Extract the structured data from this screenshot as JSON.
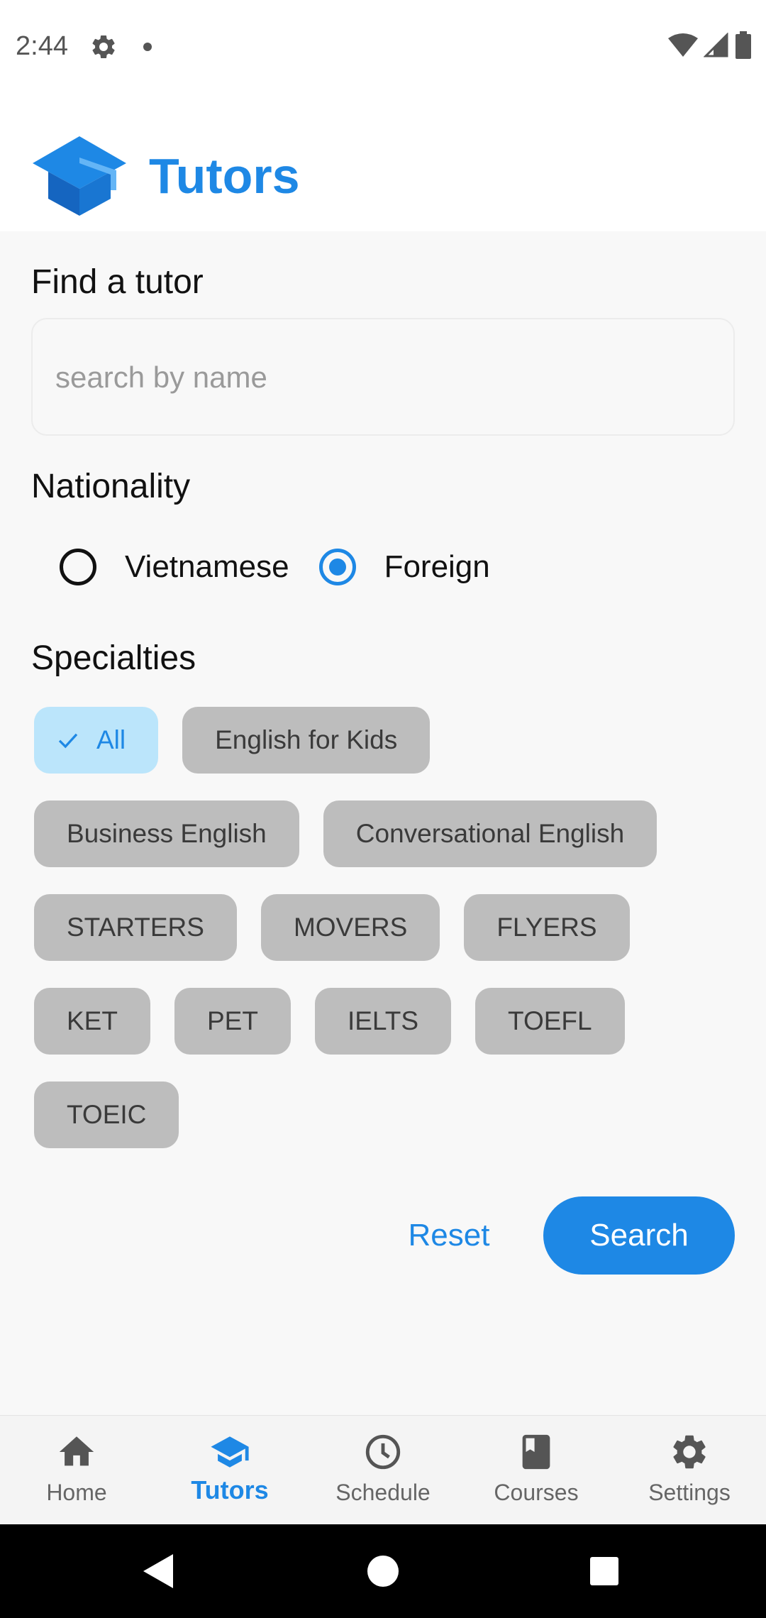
{
  "status_bar": {
    "time": "2:44"
  },
  "header": {
    "title": "Tutors"
  },
  "find": {
    "title": "Find a tutor",
    "search_value": "",
    "search_placeholder": "search by name"
  },
  "nationality": {
    "title": "Nationality",
    "options": [
      {
        "label": "Vietnamese",
        "selected": false
      },
      {
        "label": "Foreign",
        "selected": true
      }
    ]
  },
  "specialties": {
    "title": "Specialties",
    "chips": [
      {
        "label": "All",
        "selected": true
      },
      {
        "label": "English for Kids",
        "selected": false
      },
      {
        "label": "Business English",
        "selected": false
      },
      {
        "label": "Conversational English",
        "selected": false
      },
      {
        "label": "STARTERS",
        "selected": false
      },
      {
        "label": "MOVERS",
        "selected": false
      },
      {
        "label": "FLYERS",
        "selected": false
      },
      {
        "label": "KET",
        "selected": false
      },
      {
        "label": "PET",
        "selected": false
      },
      {
        "label": "IELTS",
        "selected": false
      },
      {
        "label": "TOEFL",
        "selected": false
      },
      {
        "label": "TOEIC",
        "selected": false
      }
    ]
  },
  "actions": {
    "reset_label": "Reset",
    "search_label": "Search"
  },
  "bottom_nav": {
    "items": [
      {
        "label": "Home",
        "icon": "home-icon",
        "active": false
      },
      {
        "label": "Tutors",
        "icon": "graduation-cap-icon",
        "active": true
      },
      {
        "label": "Schedule",
        "icon": "clock-icon",
        "active": false
      },
      {
        "label": "Courses",
        "icon": "book-icon",
        "active": false
      },
      {
        "label": "Settings",
        "icon": "gear-icon",
        "active": false
      }
    ]
  },
  "colors": {
    "accent": "#1e88e5",
    "chip_default": "#bdbdbd",
    "chip_selected_bg": "#bbe5fb",
    "background": "#f8f8f8"
  }
}
